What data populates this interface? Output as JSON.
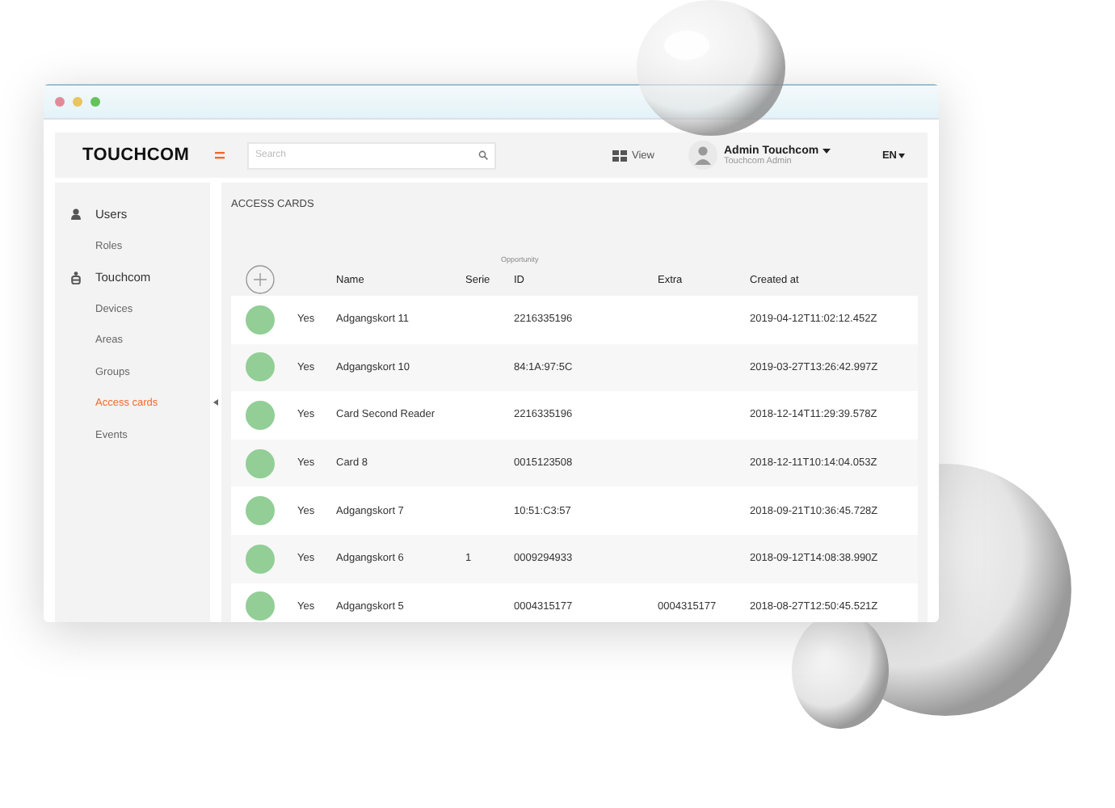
{
  "header": {
    "logo": "TOUCHCOM",
    "search": {
      "placeholder": "Search"
    },
    "view": "View",
    "user": {
      "name": "Admin Touchcom",
      "role": "Touchcom Admin"
    },
    "language": "EN"
  },
  "sidebar": {
    "sections": [
      {
        "label": "Users",
        "kind": "user",
        "children": [
          {
            "label": "Roles",
            "selected": false
          }
        ]
      },
      {
        "label": "Touchcom",
        "kind": "device",
        "children": [
          {
            "label": "Devices",
            "selected": false
          },
          {
            "label": "Areas",
            "selected": false
          },
          {
            "label": "Groups",
            "selected": false
          },
          {
            "label": "Access cards",
            "selected": true
          },
          {
            "label": "Events",
            "selected": false
          }
        ]
      }
    ]
  },
  "page": {
    "title": "ACCESS CARDS",
    "table": {
      "group_label": "Opportunity",
      "columns": [
        "Name",
        "Serie",
        "ID",
        "Extra",
        "Created at"
      ],
      "rows": [
        {
          "status": "Yes",
          "name": "Adgangskort 11",
          "id": "2216335196",
          "created_at": "2019-04-12T11:02:12.452Z"
        },
        {
          "status": "Yes",
          "name": "Adgangskort 10",
          "id": "84:1A:97:5C",
          "created_at": "2019-03-27T13:26:42.997Z"
        },
        {
          "status": "Yes",
          "name": "Card Second Reader",
          "id": "2216335196",
          "created_at": "2018-12-14T11:29:39.578Z"
        },
        {
          "status": "Yes",
          "name": "Card 8",
          "id": "0015123508",
          "created_at": "2018-12-11T10:14:04.053Z"
        },
        {
          "status": "Yes",
          "name": "Adgangskort 7",
          "id": "10:51:C3:57",
          "created_at": "2018-09-21T10:36:45.728Z"
        },
        {
          "status": "Yes",
          "name": "Adgangskort 6",
          "serie": "1",
          "id": "0009294933",
          "created_at": "2018-09-12T14:08:38.990Z"
        },
        {
          "status": "Yes",
          "name": "Adgangskort 5",
          "id": "0004315177",
          "extra": "0004315177",
          "created_at": "2018-08-27T12:50:45.521Z"
        }
      ]
    }
  }
}
